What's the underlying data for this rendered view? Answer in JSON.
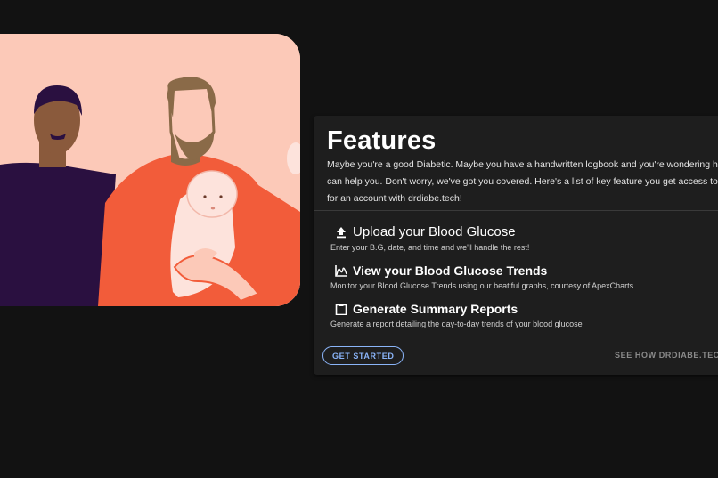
{
  "features": {
    "title": "Features",
    "intro_lines": [
      "Maybe you're a good Diabetic. Maybe you have a handwritten logbook and you're wondering how dr",
      "can help you. Don't worry, we've got you covered. Here's a list of key feature you get access to when",
      "for an account with drdiabe.tech!"
    ],
    "items": [
      {
        "icon": "upload-icon",
        "label": "Upload your Blood Glucose",
        "desc": "Enter your B.G, date, and time and we'll handle the rest!"
      },
      {
        "icon": "trend-chart-icon",
        "label": "View your Blood Glucose Trends",
        "desc": "Monitor your Blood Glucose Trends using our beatiful graphs, courtesy of ApexCharts."
      },
      {
        "icon": "clipboard-icon",
        "label": "Generate Summary Reports",
        "desc": "Generate a report detailing the day-to-day trends of your blood glucose"
      }
    ],
    "actions": {
      "get_started": "GET STARTED",
      "see_how": "SEE HOW DRDIABE.TECH"
    }
  },
  "colors": {
    "background": "#121212",
    "card": "#1e1e1e",
    "accent": "#8ab4f8",
    "hero_bg": "#fcc9b8"
  }
}
